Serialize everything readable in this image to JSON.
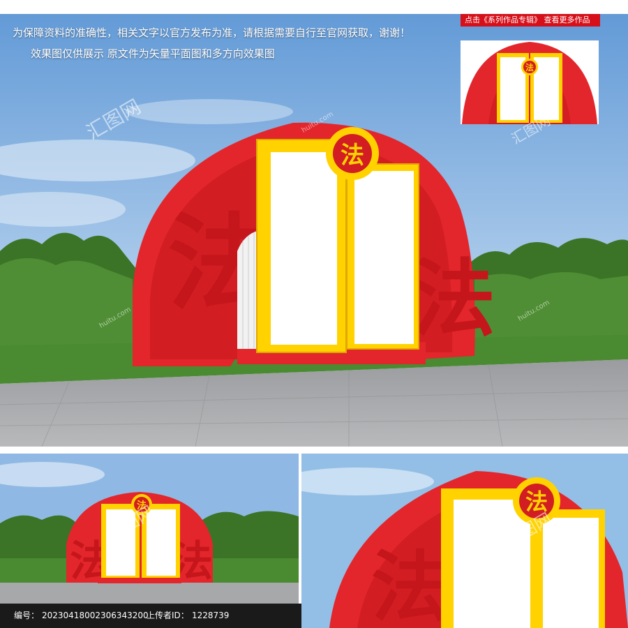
{
  "header": {
    "promo_text": "点击《系列作品专辑》 查看更多作品"
  },
  "notices": {
    "line1": "为保障资料的准确性，相关文字以官方发布为准，请根据需要自行至官网获取，谢谢！",
    "line2": "效果图仅供展示  原文件为矢量平面图和多方向效果图"
  },
  "sign": {
    "badge_char": "法",
    "relief_char": "法",
    "colors": {
      "red": "#e3262c",
      "dark_red": "#b8141a",
      "yellow": "#ffd200",
      "sky": "#6aa0d8",
      "grass": "#3e7d2b"
    }
  },
  "watermark": {
    "brand": "汇图网",
    "domain": "huitu.com"
  },
  "footer": {
    "id_label": "编号：",
    "id_value": "20230418002306343200",
    "uploader_label": "上传者ID：",
    "uploader_value": "1228739"
  }
}
